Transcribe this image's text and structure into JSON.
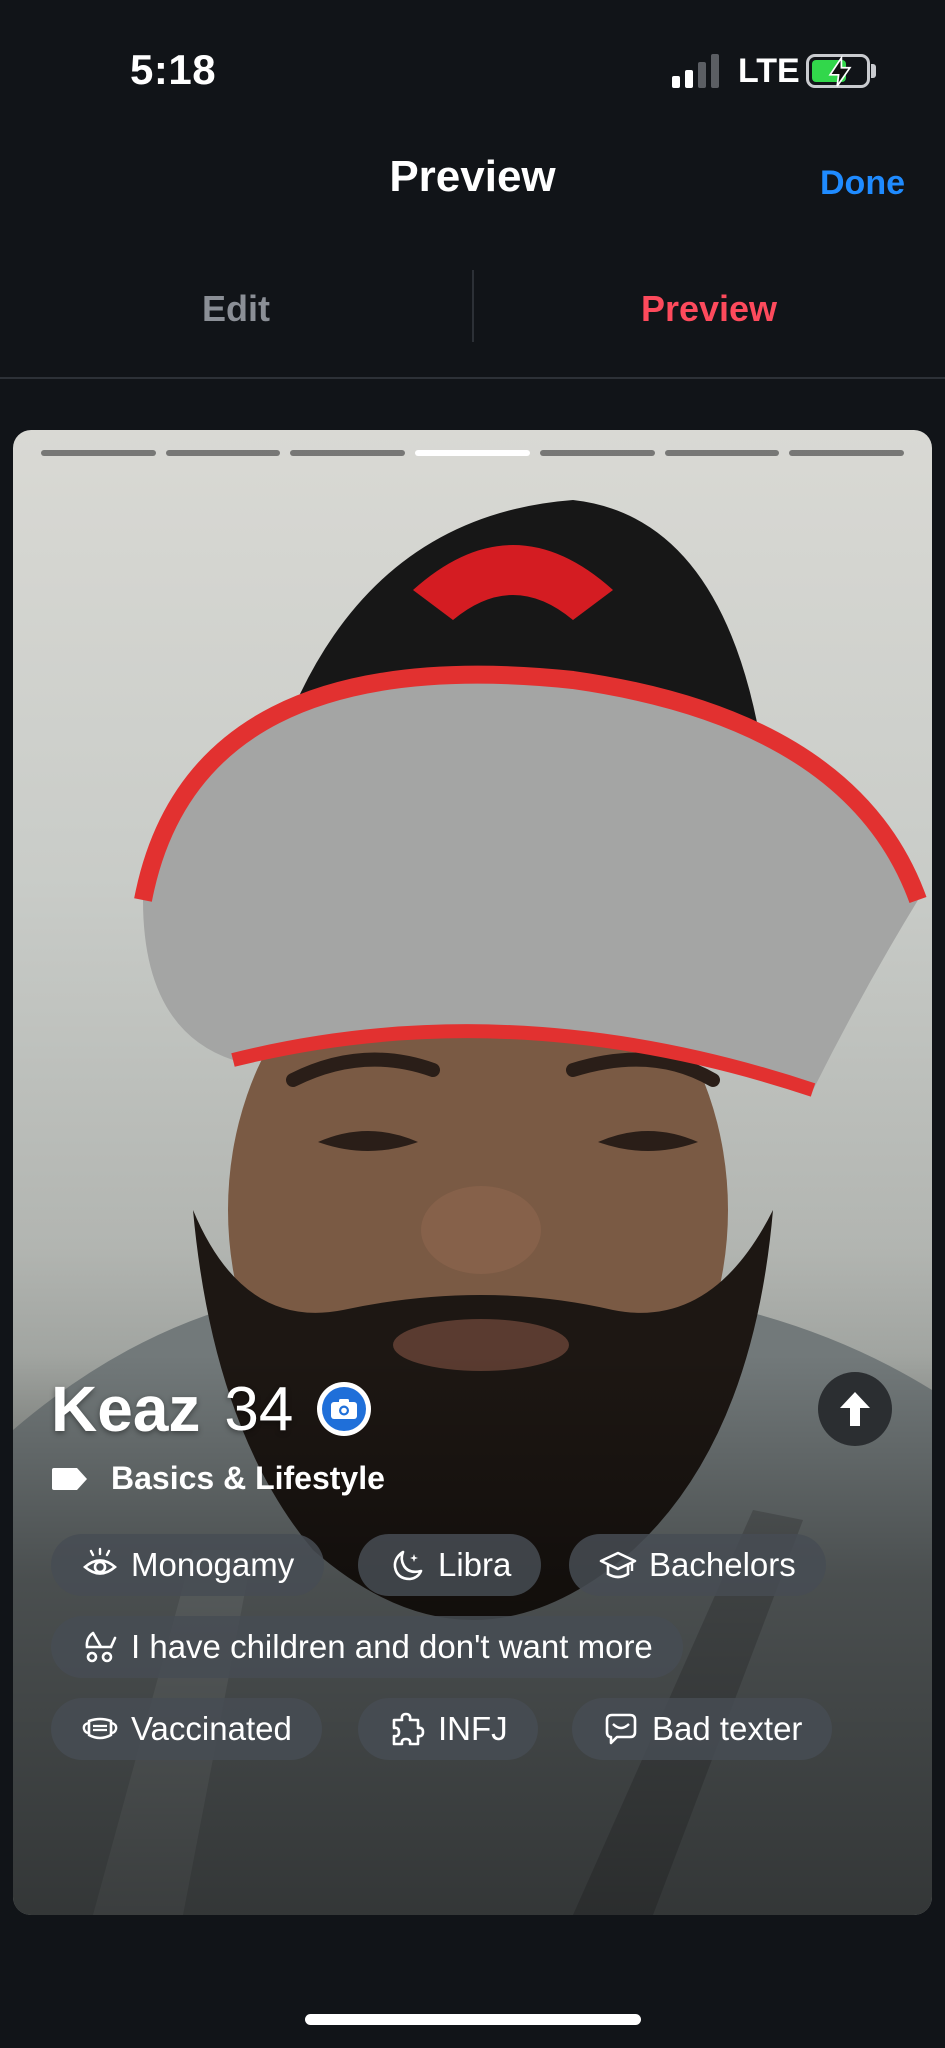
{
  "status_bar": {
    "time": "5:18",
    "network": "LTE"
  },
  "nav": {
    "title": "Preview",
    "done_label": "Done"
  },
  "tabs": [
    {
      "label": "Edit"
    },
    {
      "label": "Preview"
    }
  ],
  "profile": {
    "name": "Keaz",
    "age": "34",
    "photo_count": 7,
    "active_photo": 4,
    "section_label": "Basics & Lifestyle",
    "chips": [
      {
        "label": "Monogamy",
        "icon": "eye-icon"
      },
      {
        "label": "Libra",
        "icon": "moon-icon"
      },
      {
        "label": "Bachelors",
        "icon": "graduation-cap-icon"
      },
      {
        "label": "I have children and don't want more",
        "icon": "stroller-icon"
      },
      {
        "label": "Vaccinated",
        "icon": "face-mask-icon"
      },
      {
        "label": "INFJ",
        "icon": "puzzle-icon"
      },
      {
        "label": "Bad texter",
        "icon": "chat-bubble-icon"
      }
    ]
  },
  "colors": {
    "accent_red": "#fd4a5c",
    "accent_blue": "#1f8bff",
    "background": "#111418"
  }
}
